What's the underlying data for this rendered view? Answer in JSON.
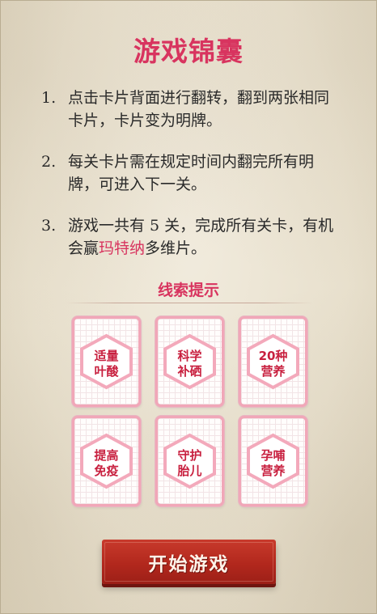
{
  "title": "游戏锦囊",
  "rules": [
    {
      "num": "1.",
      "text": "点击卡片背面进行翻转，翻到两张相同卡片，卡片变为明牌。"
    },
    {
      "num": "2.",
      "text": "每关卡片需在规定时间内翻完所有明牌，可进入下一关。"
    },
    {
      "num": "3.",
      "text_before": "游戏一共有 5 关，完成所有关卡，有机会赢",
      "highlight": "玛特纳",
      "text_after": "多维片。"
    }
  ],
  "hints": {
    "title": "线索提示",
    "cards": [
      {
        "line1": "适量",
        "line2": "叶酸"
      },
      {
        "line1": "科学",
        "line2": "补硒"
      },
      {
        "line1": "20种",
        "line2": "营养"
      },
      {
        "line1": "提高",
        "line2": "免疫"
      },
      {
        "line1": "守护",
        "line2": "胎儿"
      },
      {
        "line1": "孕哺",
        "line2": "营养"
      }
    ]
  },
  "start_button": "开始游戏",
  "colors": {
    "accent": "#d8345f",
    "card_border": "#f1a7b8",
    "card_text": "#c8203f",
    "button": "#b2281d",
    "background": "#efe8d8"
  }
}
